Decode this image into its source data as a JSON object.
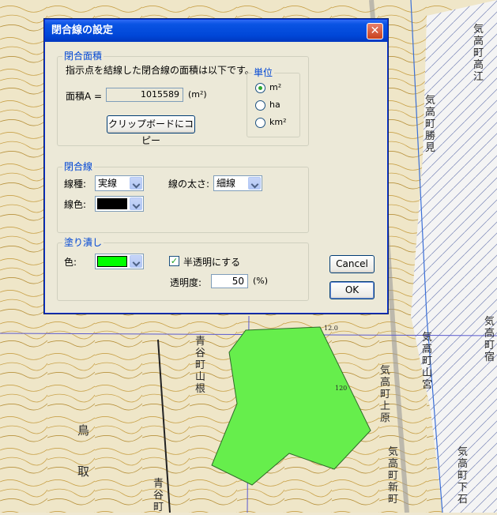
{
  "map": {
    "labels": [
      "鳥",
      "取",
      "気高町高江",
      "気高町勝見",
      "気高町山宮",
      "気高町上原",
      "気高町新町",
      "気高町下石",
      "青谷町山根",
      "青谷町",
      "気高町宿",
      "12.0",
      "120"
    ]
  },
  "dialog": {
    "title": "閉合線の設定",
    "close_icon": "close-icon",
    "area_group": {
      "legend": "閉合面積",
      "description": "指示点を結線した閉合線の面積は以下です。",
      "area_label": "面積A =",
      "area_value": "1015589",
      "area_unit": "(m²)",
      "copy_button": "クリップボードにコピー",
      "unit_group": {
        "legend": "単位",
        "options": [
          "m²",
          "ha",
          "km²"
        ],
        "selected": "m²"
      }
    },
    "line_group": {
      "legend": "閉合線",
      "type_label": "線種:",
      "type_value": "実線",
      "width_label": "線の太さ:",
      "width_value": "細線",
      "color_label": "線色:",
      "color_value": "#000000"
    },
    "fill_group": {
      "legend": "塗り潰し",
      "color_label": "色:",
      "color_value": "#00ff00",
      "translucent_label": "半透明にする",
      "translucent_checked": true,
      "opacity_label": "透明度:",
      "opacity_value": "50",
      "opacity_unit": "(%)"
    },
    "cancel_button": "Cancel",
    "ok_button": "OK"
  },
  "colors": {
    "accent": "#0046d5",
    "polygon_fill": "#66ee4c",
    "titlebar": "#0a54e3"
  }
}
